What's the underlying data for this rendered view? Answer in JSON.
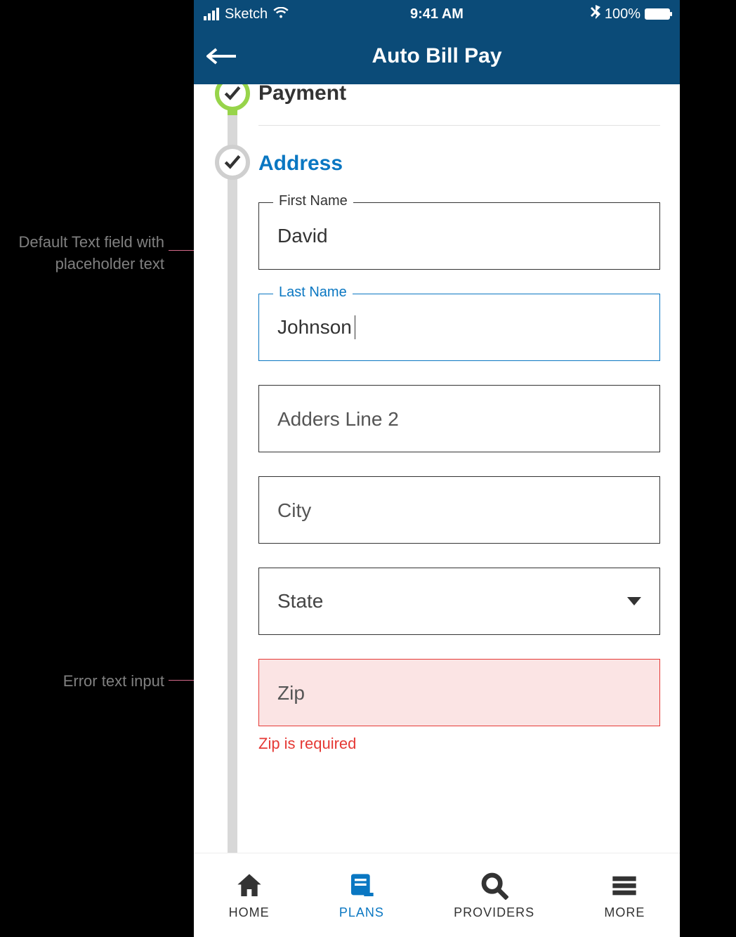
{
  "annotations": {
    "default_field": "Default Text field  with placeholder text",
    "error_field": "Error text input"
  },
  "statusbar": {
    "carrier": "Sketch",
    "time": "9:41 AM",
    "battery_pct": "100%"
  },
  "header": {
    "title": "Auto Bill Pay"
  },
  "stepper": {
    "payment_label": "Payment",
    "address_label": "Address"
  },
  "form": {
    "first_name_label": "First Name",
    "first_name_value": "David",
    "last_name_label": "Last Name",
    "last_name_value": "Johnson",
    "address2_placeholder": "Adders Line 2",
    "city_placeholder": "City",
    "state_placeholder": "State",
    "zip_placeholder": "Zip",
    "zip_error": "Zip is required"
  },
  "tabbar": {
    "home": "HOME",
    "plans": "PLANS",
    "providers": "PROVIDERS",
    "more": "MORE"
  }
}
